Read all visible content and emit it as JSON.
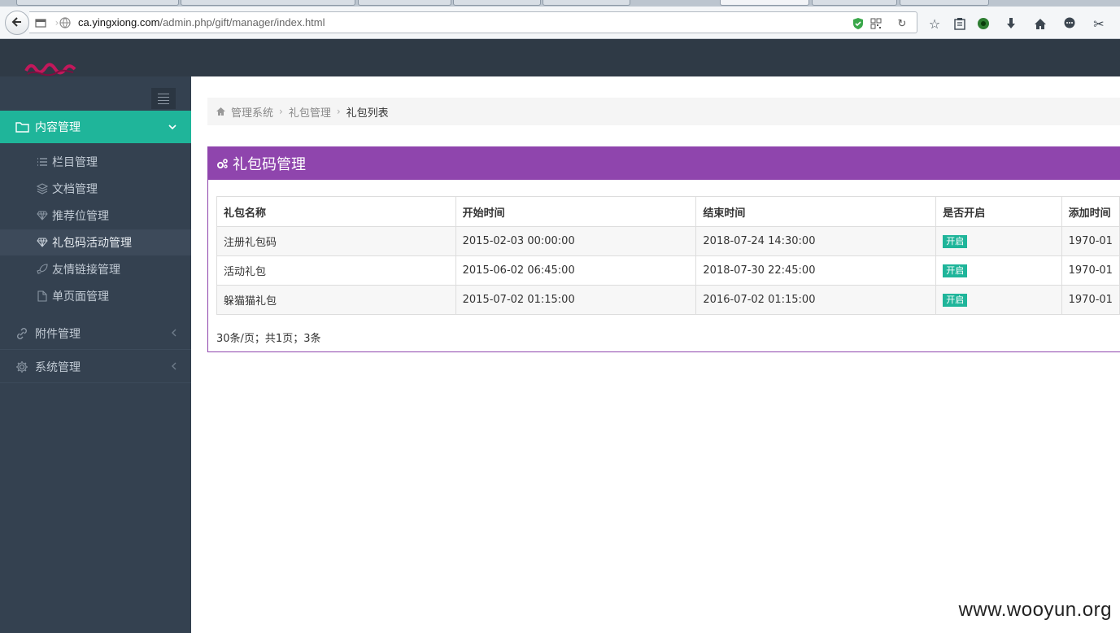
{
  "browser": {
    "url_host": "ca.yingxiong.com",
    "url_path": "/admin.php/gift/manager/index.html"
  },
  "sidebar": {
    "groups": [
      {
        "label": "内容管理",
        "items": [
          {
            "label": "栏目管理"
          },
          {
            "label": "文档管理"
          },
          {
            "label": "推荐位管理"
          },
          {
            "label": "礼包码活动管理"
          },
          {
            "label": "友情链接管理"
          },
          {
            "label": "单页面管理"
          }
        ]
      },
      {
        "label": "附件管理"
      },
      {
        "label": "系统管理"
      }
    ]
  },
  "breadcrumb": {
    "items": [
      "管理系统",
      "礼包管理"
    ],
    "current": "礼包列表"
  },
  "panel": {
    "title": "礼包码管理"
  },
  "table": {
    "headers": [
      "礼包名称",
      "开始时间",
      "结束时间",
      "是否开启",
      "添加时间"
    ],
    "rows": [
      {
        "name": "注册礼包码",
        "start": "2015-02-03 00:00:00",
        "end": "2018-07-24 14:30:00",
        "status": "开启",
        "added": "1970-01"
      },
      {
        "name": "活动礼包",
        "start": "2015-06-02 06:45:00",
        "end": "2018-07-30 22:45:00",
        "status": "开启",
        "added": "1970-01"
      },
      {
        "name": "躲猫猫礼包",
        "start": "2015-07-02 01:15:00",
        "end": "2016-07-02 01:15:00",
        "status": "开启",
        "added": "1970-01"
      }
    ]
  },
  "pagination": {
    "summary": "30条/页；共1页；3条"
  },
  "watermark": "www.wooyun.org",
  "colors": {
    "header": "#2f3a46",
    "sidebar": "#344150",
    "active_menu": "#1fb59a",
    "panel_accent": "#8f45ad",
    "badge": "#1fb59a"
  }
}
